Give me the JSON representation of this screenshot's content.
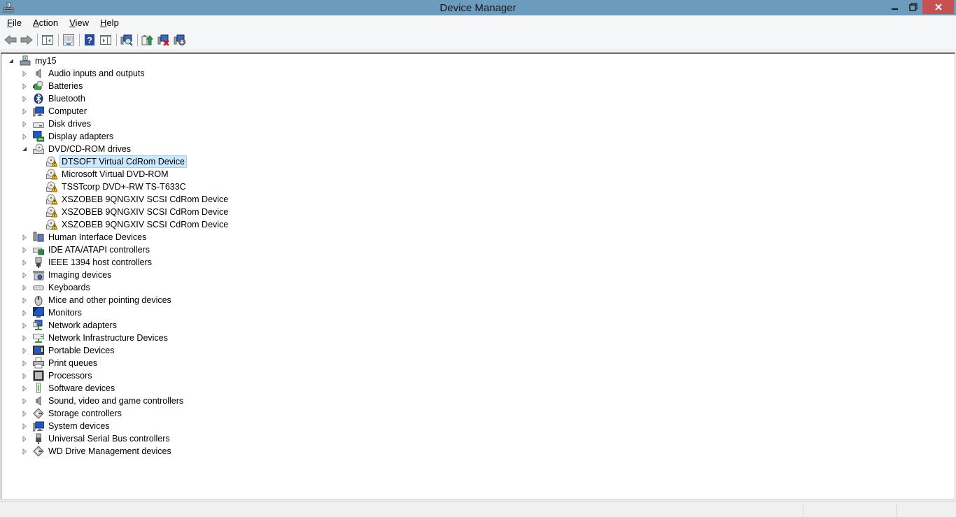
{
  "window": {
    "title": "Device Manager",
    "controls": {
      "minimize": "minimize",
      "restore": "restore",
      "close": "close"
    }
  },
  "menu": [
    {
      "label": "File",
      "accel": "F",
      "rest": "ile"
    },
    {
      "label": "Action",
      "accel": "A",
      "rest": "ction"
    },
    {
      "label": "View",
      "accel": "V",
      "rest": "iew"
    },
    {
      "label": "Help",
      "accel": "H",
      "rest": "elp"
    }
  ],
  "toolbar": [
    {
      "name": "back-button",
      "icon": "arrow-left-icon"
    },
    {
      "name": "forward-button",
      "icon": "arrow-right-icon"
    },
    {
      "sep": true
    },
    {
      "name": "show-hide-console-tree-button",
      "icon": "console-tree-icon"
    },
    {
      "sep": true
    },
    {
      "name": "properties-button",
      "icon": "properties-icon"
    },
    {
      "sep": true
    },
    {
      "name": "help-button",
      "icon": "help-icon"
    },
    {
      "name": "show-hide-action-pane-button",
      "icon": "action-pane-icon"
    },
    {
      "sep": true
    },
    {
      "name": "scan-hardware-changes-button",
      "icon": "scan-hardware-icon"
    },
    {
      "sep": true
    },
    {
      "name": "update-driver-button",
      "icon": "update-driver-icon"
    },
    {
      "name": "uninstall-device-button",
      "icon": "uninstall-device-icon"
    },
    {
      "name": "disable-device-button",
      "icon": "disable-device-icon"
    }
  ],
  "tree": {
    "root": {
      "label": "my15",
      "expanded": true,
      "icon": "computer-root-icon"
    },
    "categories": [
      {
        "label": "Audio inputs and outputs",
        "icon": "speaker-icon",
        "expanded": false
      },
      {
        "label": "Batteries",
        "icon": "battery-icon",
        "expanded": false
      },
      {
        "label": "Bluetooth",
        "icon": "bluetooth-icon",
        "expanded": false
      },
      {
        "label": "Computer",
        "icon": "computer-icon",
        "expanded": false
      },
      {
        "label": "Disk drives",
        "icon": "disk-drive-icon",
        "expanded": false
      },
      {
        "label": "Display adapters",
        "icon": "display-adapter-icon",
        "expanded": false
      },
      {
        "label": "DVD/CD-ROM drives",
        "icon": "dvd-drive-icon",
        "expanded": true,
        "children": [
          {
            "label": "DTSOFT Virtual CdRom Device",
            "icon": "dvd-warning-icon",
            "selected": true
          },
          {
            "label": "Microsoft Virtual DVD-ROM",
            "icon": "dvd-warning-icon"
          },
          {
            "label": "TSSTcorp DVD+-RW TS-T633C",
            "icon": "dvd-warning-icon"
          },
          {
            "label": "XSZOBEB 9QNGXIV SCSI CdRom Device",
            "icon": "dvd-warning-icon"
          },
          {
            "label": "XSZOBEB 9QNGXIV SCSI CdRom Device",
            "icon": "dvd-warning-icon"
          },
          {
            "label": "XSZOBEB 9QNGXIV SCSI CdRom Device",
            "icon": "dvd-warning-icon"
          }
        ]
      },
      {
        "label": "Human Interface Devices",
        "icon": "hid-icon",
        "expanded": false
      },
      {
        "label": "IDE ATA/ATAPI controllers",
        "icon": "ide-controller-icon",
        "expanded": false
      },
      {
        "label": "IEEE 1394 host controllers",
        "icon": "ieee1394-icon",
        "expanded": false
      },
      {
        "label": "Imaging devices",
        "icon": "camera-icon",
        "expanded": false
      },
      {
        "label": "Keyboards",
        "icon": "keyboard-icon",
        "expanded": false
      },
      {
        "label": "Mice and other pointing devices",
        "icon": "mouse-icon",
        "expanded": false
      },
      {
        "label": "Monitors",
        "icon": "monitor-icon",
        "expanded": false
      },
      {
        "label": "Network adapters",
        "icon": "network-adapter-icon",
        "expanded": false
      },
      {
        "label": "Network Infrastructure Devices",
        "icon": "network-infrastructure-icon",
        "expanded": false
      },
      {
        "label": "Portable Devices",
        "icon": "portable-device-icon",
        "expanded": false
      },
      {
        "label": "Print queues",
        "icon": "printer-icon",
        "expanded": false
      },
      {
        "label": "Processors",
        "icon": "processor-icon",
        "expanded": false
      },
      {
        "label": "Software devices",
        "icon": "software-device-icon",
        "expanded": false
      },
      {
        "label": "Sound, video and game controllers",
        "icon": "speaker-icon",
        "expanded": false
      },
      {
        "label": "Storage controllers",
        "icon": "storage-controller-icon",
        "expanded": false
      },
      {
        "label": "System devices",
        "icon": "computer-icon",
        "expanded": false
      },
      {
        "label": "Universal Serial Bus controllers",
        "icon": "usb-icon",
        "expanded": false
      },
      {
        "label": "WD Drive Management devices",
        "icon": "storage-controller-icon",
        "expanded": false
      }
    ]
  },
  "colors": {
    "titlebar": "#6b9bbd",
    "close": "#c75050",
    "selection_bg": "#cce8ff",
    "selection_border": "#99d1ff"
  }
}
